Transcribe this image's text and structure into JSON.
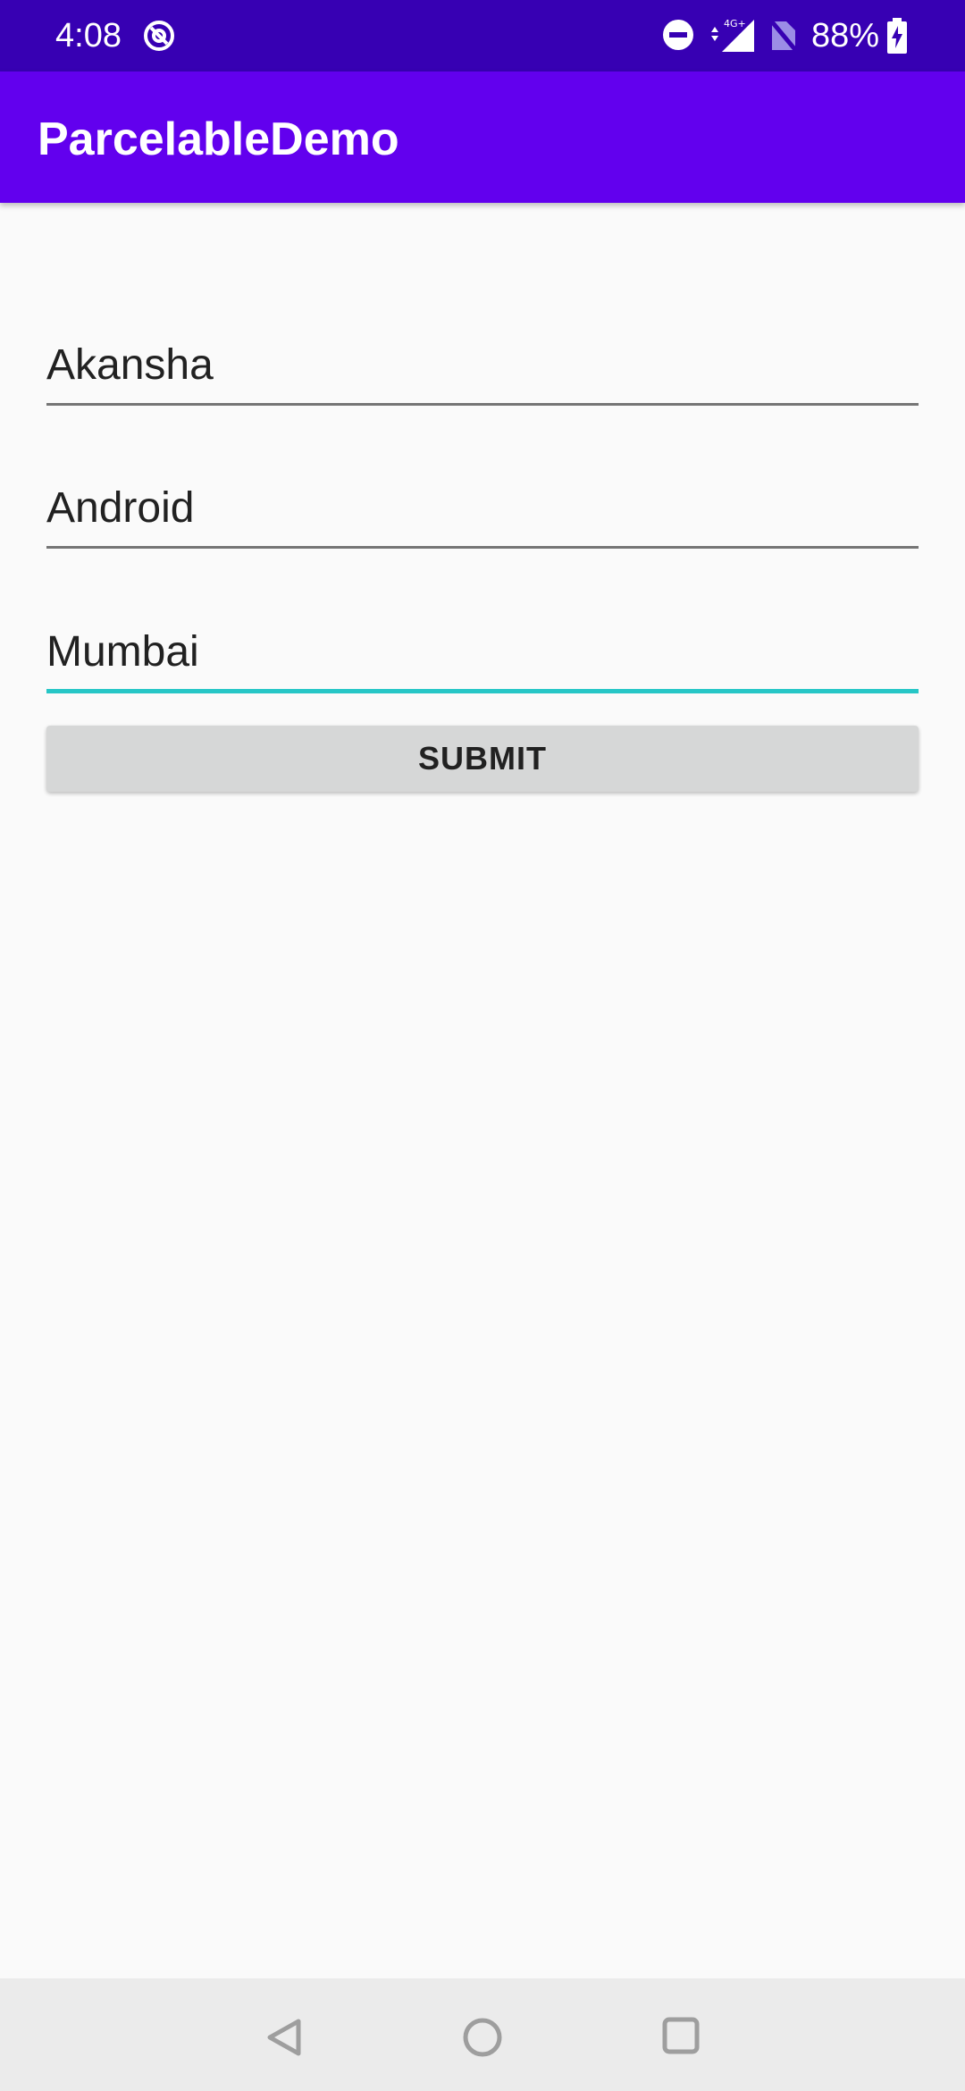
{
  "status_bar": {
    "time": "4:08",
    "battery_percent": "88%",
    "network_label": "4G+",
    "icons": [
      "data-saver-icon",
      "do-not-disturb-icon",
      "signal-icon",
      "no-sim-icon",
      "battery-charging-icon"
    ],
    "background_color": "#3700b3"
  },
  "app_bar": {
    "title": "ParcelableDemo",
    "background_color": "#6200ee"
  },
  "form": {
    "fields": [
      {
        "value": "Akansha",
        "focused": false
      },
      {
        "value": "Android",
        "focused": false
      },
      {
        "value": "Mumbai",
        "focused": true
      }
    ],
    "focus_color": "#26c6c6",
    "submit_label": "SUBMIT"
  },
  "nav_bar": {
    "icons": [
      "back-icon",
      "home-icon",
      "recents-icon"
    ]
  }
}
